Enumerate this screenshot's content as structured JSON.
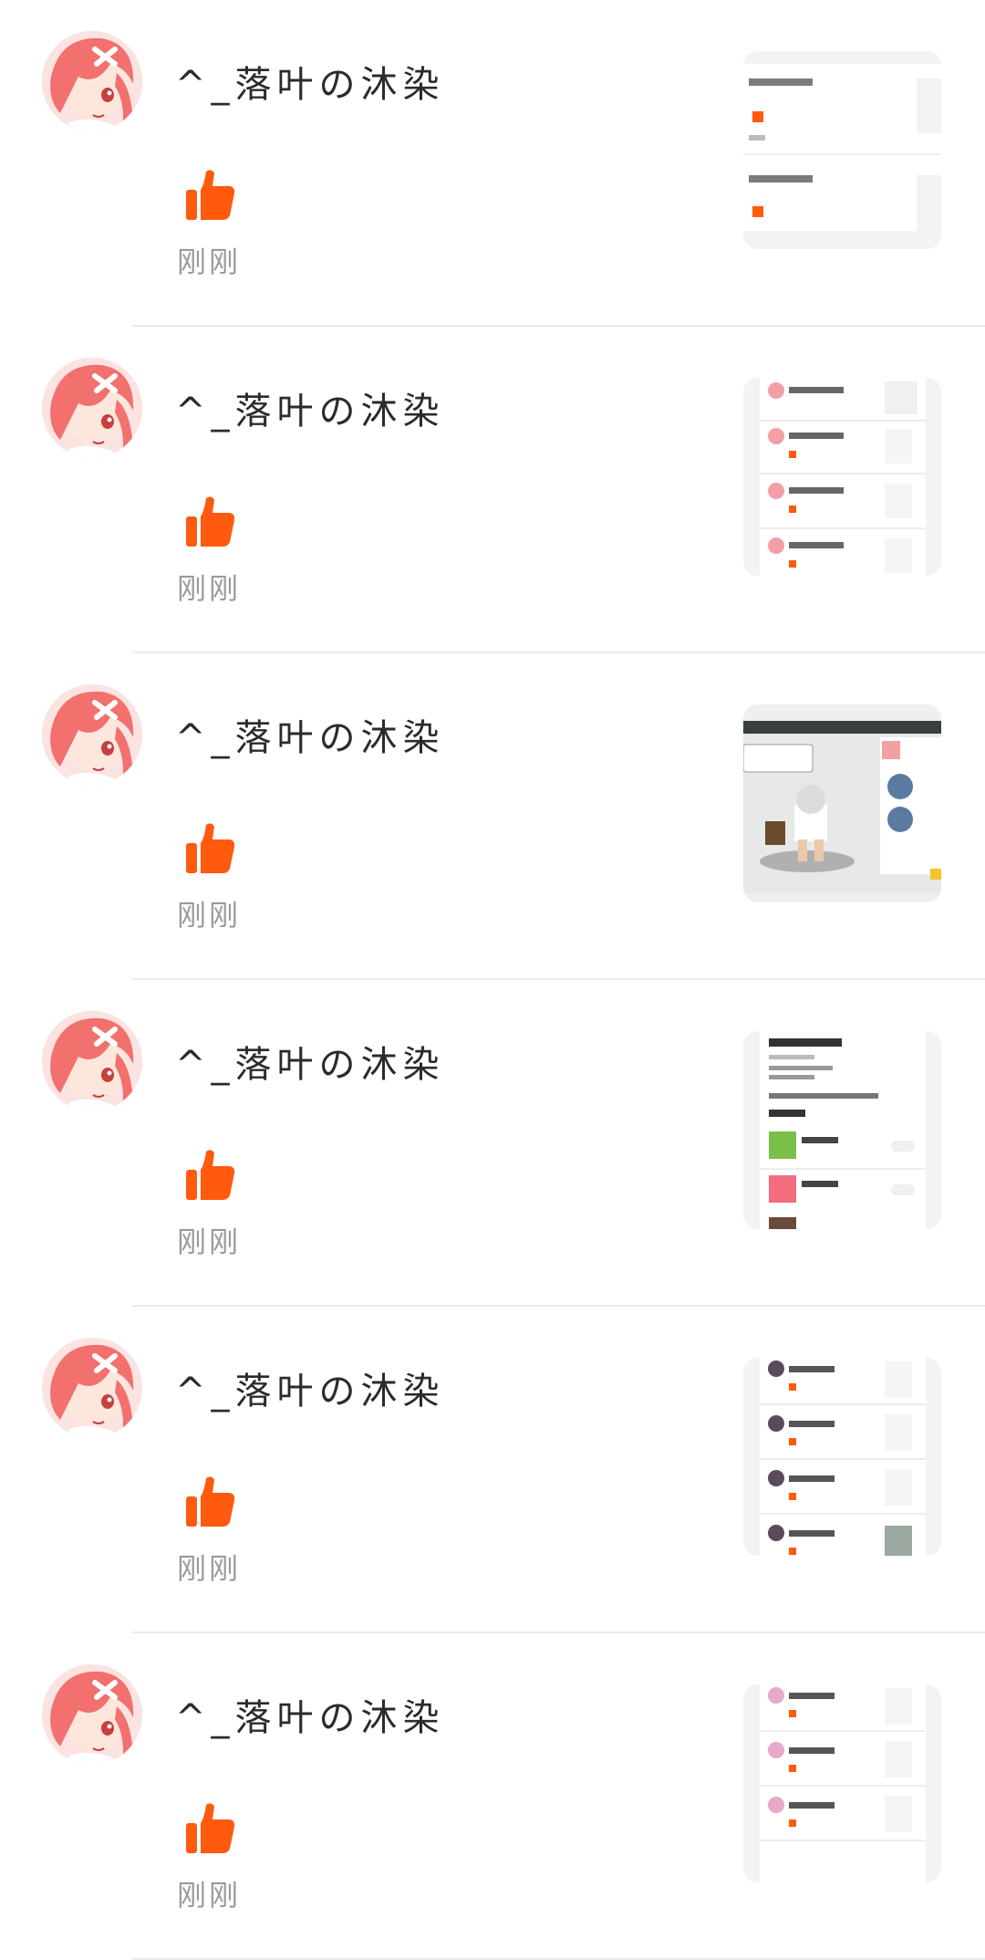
{
  "items": [
    {
      "username": "^_落叶の沐染",
      "time": "刚刚",
      "thumb_kind": "comment-list"
    },
    {
      "username": "^_落叶の沐染",
      "time": "刚刚",
      "thumb_kind": "post-list"
    },
    {
      "username": "^_落叶の沐染",
      "time": "刚刚",
      "thumb_kind": "game-scene"
    },
    {
      "username": "^_落叶の沐染",
      "time": "刚刚",
      "thumb_kind": "profile"
    },
    {
      "username": "^_落叶の沐染",
      "time": "刚刚",
      "thumb_kind": "post-list"
    },
    {
      "username": "^_落叶の沐染",
      "time": "刚刚",
      "thumb_kind": "post-list"
    }
  ],
  "colors": {
    "like": "#ff5a0e",
    "username": "#2b2b2b",
    "time": "#9a9a9a",
    "divider": "#ebebeb",
    "avatar_hair": "#f2706e"
  },
  "icons": {
    "like": "thumbs-up-icon",
    "avatar": "anime-avatar"
  }
}
